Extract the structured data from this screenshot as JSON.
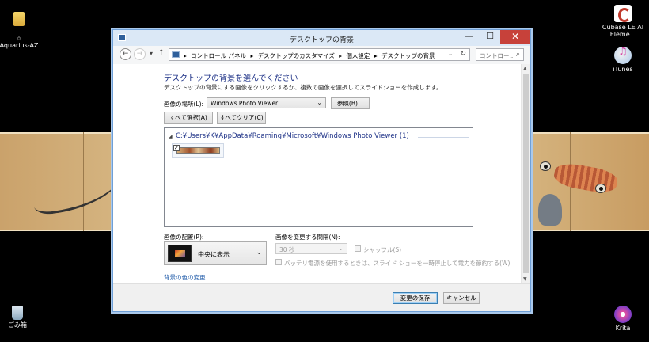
{
  "desktop": {
    "icons": [
      {
        "label": "☆\nAquarius-AZ"
      },
      {
        "label": "Cubase LE AI Eleme..."
      },
      {
        "label": "iTunes"
      },
      {
        "label": "ごみ箱"
      },
      {
        "label": "Krita"
      }
    ]
  },
  "window": {
    "title": "デスクトップの背景",
    "buttons": {
      "minimize": "—",
      "maximize": "☐",
      "close": "✕"
    }
  },
  "nav": {
    "back": "←",
    "forward": "→",
    "recent": "▾",
    "up": "↑",
    "breadcrumbs": [
      "▸",
      "コントロール パネル",
      "▸",
      "デスクトップのカスタマイズ",
      "▸",
      "個人設定",
      "▸",
      "デスクトップの背景"
    ],
    "dropdown": "⌄",
    "refresh": "↻",
    "search_placeholder": "コントロー...",
    "search_icon": "⌕"
  },
  "content": {
    "heading": "デスクトップの背景を選んでください",
    "subtext": "デスクトップの背景にする画像をクリックするか、複数の画像を選択してスライドショーを作成します。",
    "location_label": "画像の場所(L):",
    "location_value": "Windows Photo Viewer",
    "browse_button": "参照(B)...",
    "select_all_button": "すべて選択(A)",
    "clear_all_button": "すべてクリア(C)",
    "group_toggle": "◢",
    "group_path": "C:¥Users¥K¥AppData¥Roaming¥Microsoft¥Windows Photo Viewer (1)",
    "thumb_check": "✓",
    "position_label": "画像の配置(P):",
    "position_value": "中央に表示",
    "interval_label": "画像を変更する間隔(N):",
    "interval_value": "30 秒",
    "shuffle_label": "シャッフル(S)",
    "battery_label": "バッテリ電源を使用するときは、スライド ショーを一時停止して電力を節約する(W)",
    "bg_color_link": "背景の色の変更"
  },
  "footer": {
    "save_button": "変更の保存",
    "cancel_button": "キャンセル"
  }
}
